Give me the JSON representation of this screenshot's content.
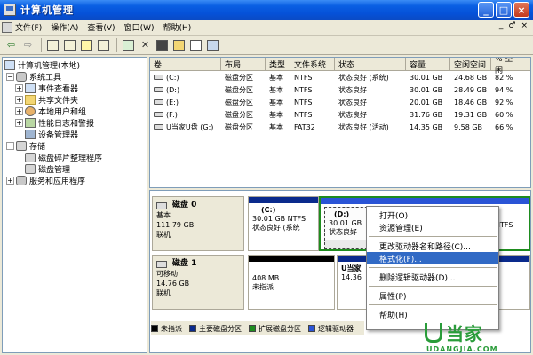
{
  "window": {
    "title": "计算机管理",
    "min": "_",
    "max": "□",
    "close": "×"
  },
  "menu": {
    "items": [
      "文件(F)",
      "操作(A)",
      "查看(V)",
      "窗口(W)",
      "帮助(H)"
    ],
    "right": [
      "_",
      "♂",
      "×"
    ]
  },
  "toolbar": {
    "back": "⇦",
    "forward": "⇨"
  },
  "tree": {
    "root": "计算机管理(本地)",
    "system_tools": "系统工具",
    "event_viewer": "事件查看器",
    "shared_folders": "共享文件夹",
    "local_users": "本地用户和组",
    "perf_logs": "性能日志和警报",
    "device_manager": "设备管理器",
    "storage": "存储",
    "defrag": "磁盘碎片整理程序",
    "disk_mgmt": "磁盘管理",
    "services": "服务和应用程序"
  },
  "volume_list": {
    "headers": [
      "卷",
      "布局",
      "类型",
      "文件系统",
      "状态",
      "容量",
      "空闲空间",
      "% 空闲"
    ],
    "rows": [
      [
        "(C:)",
        "磁盘分区",
        "基本",
        "NTFS",
        "状态良好 (系统)",
        "30.01 GB",
        "24.68 GB",
        "82 %"
      ],
      [
        "(D:)",
        "磁盘分区",
        "基本",
        "NTFS",
        "状态良好",
        "30.01 GB",
        "28.49 GB",
        "94 %"
      ],
      [
        "(E:)",
        "磁盘分区",
        "基本",
        "NTFS",
        "状态良好",
        "20.01 GB",
        "18.46 GB",
        "92 %"
      ],
      [
        "(F:)",
        "磁盘分区",
        "基本",
        "NTFS",
        "状态良好",
        "31.76 GB",
        "19.31 GB",
        "60 %"
      ],
      [
        "U当家U盘 (G:)",
        "磁盘分区",
        "基本",
        "FAT32",
        "状态良好 (活动)",
        "14.35 GB",
        "9.58 GB",
        "66 %"
      ]
    ]
  },
  "disks": {
    "disk0": {
      "name": "磁盘 0",
      "type": "基本",
      "size": "111.79 GB",
      "status": "联机",
      "part_c_name": "(C:)",
      "part_c_detail": "30.01 GB NTFS",
      "part_c_status": "状态良好 (系统",
      "part_d_name": "(D:)",
      "part_d_detail": "30.01 GB",
      "part_d_status": "状态良好",
      "part_f_fs": "NTFS"
    },
    "disk1": {
      "name": "磁盘 1",
      "type": "可移动",
      "size": "14.76 GB",
      "status": "联机",
      "un_size": "408 MB",
      "un_label": "未指派",
      "part_g_name": "U当家",
      "part_g_size": "14.36"
    }
  },
  "legend": {
    "unallocated": "未指派",
    "primary": "主要磁盘分区",
    "extended": "扩展磁盘分区",
    "logical": "逻辑驱动器"
  },
  "context_menu": {
    "items": [
      "打开(O)",
      "资源管理(E)",
      "更改驱动器名和路径(C)...",
      "格式化(F)...",
      "删除逻辑驱动器(D)...",
      "属性(P)",
      "帮助(H)"
    ]
  },
  "watermark": {
    "brand": "当家",
    "url": "UDANGJIA.COM"
  },
  "colors": {
    "primary": "#0a2a8c",
    "extended": "#1e8c1e",
    "unallocated": "#000000",
    "logical": "#2a54d6",
    "menu_highlight": "#316ac5"
  }
}
